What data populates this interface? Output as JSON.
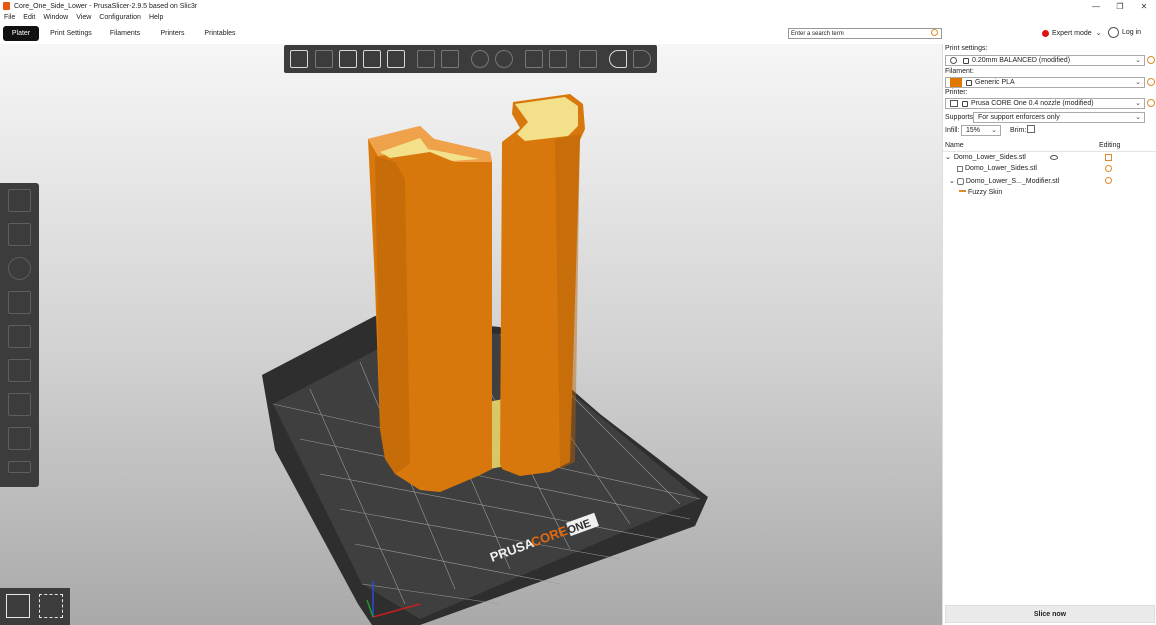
{
  "window": {
    "title": "Core_One_Side_Lower - PrusaSlicer-2.9.5 based on Slic3r",
    "minimize": "—",
    "maximize": "❐",
    "close": "✕"
  },
  "menu": [
    "File",
    "Edit",
    "Window",
    "View",
    "Configuration",
    "Help"
  ],
  "tabs": [
    "Plater",
    "Print Settings",
    "Filaments",
    "Printers",
    "Printables"
  ],
  "search": {
    "placeholder": "Enter a search term"
  },
  "mode": {
    "label": "Expert mode",
    "color": "#e01010"
  },
  "login": {
    "label": "Log in"
  },
  "panel": {
    "print_label": "Print settings:",
    "print_value": "0.20mm BALANCED (modified)",
    "filament_label": "Filament:",
    "filament_value": "Generic PLA",
    "filament_color": "#e07800",
    "printer_label": "Printer:",
    "printer_value": "Prusa CORE One 0.4 nozzle (modified)",
    "supports_label": "Supports:",
    "supports_value": "For support enforcers only",
    "infill_label": "Infill:",
    "infill_value": "15%",
    "brim_label": "Brim:",
    "col_name": "Name",
    "col_editing": "Editing",
    "objects": {
      "root": "Domo_Lower_Sides.stl",
      "part": "Domo_Lower_Sides.stl",
      "modifier": "Domo_Lower_S..._Modifier.stl",
      "setting": "Fuzzy Skin"
    },
    "slice_label": "Slice now"
  },
  "bed": {
    "brand_a": "PRUSA",
    "brand_b": "CORE",
    "brand_c": "ONE"
  },
  "colors": {
    "model": "#d8780c",
    "modifier": "#e8d66a",
    "bed": "#3b3b3b",
    "accent": "#e08a30"
  }
}
